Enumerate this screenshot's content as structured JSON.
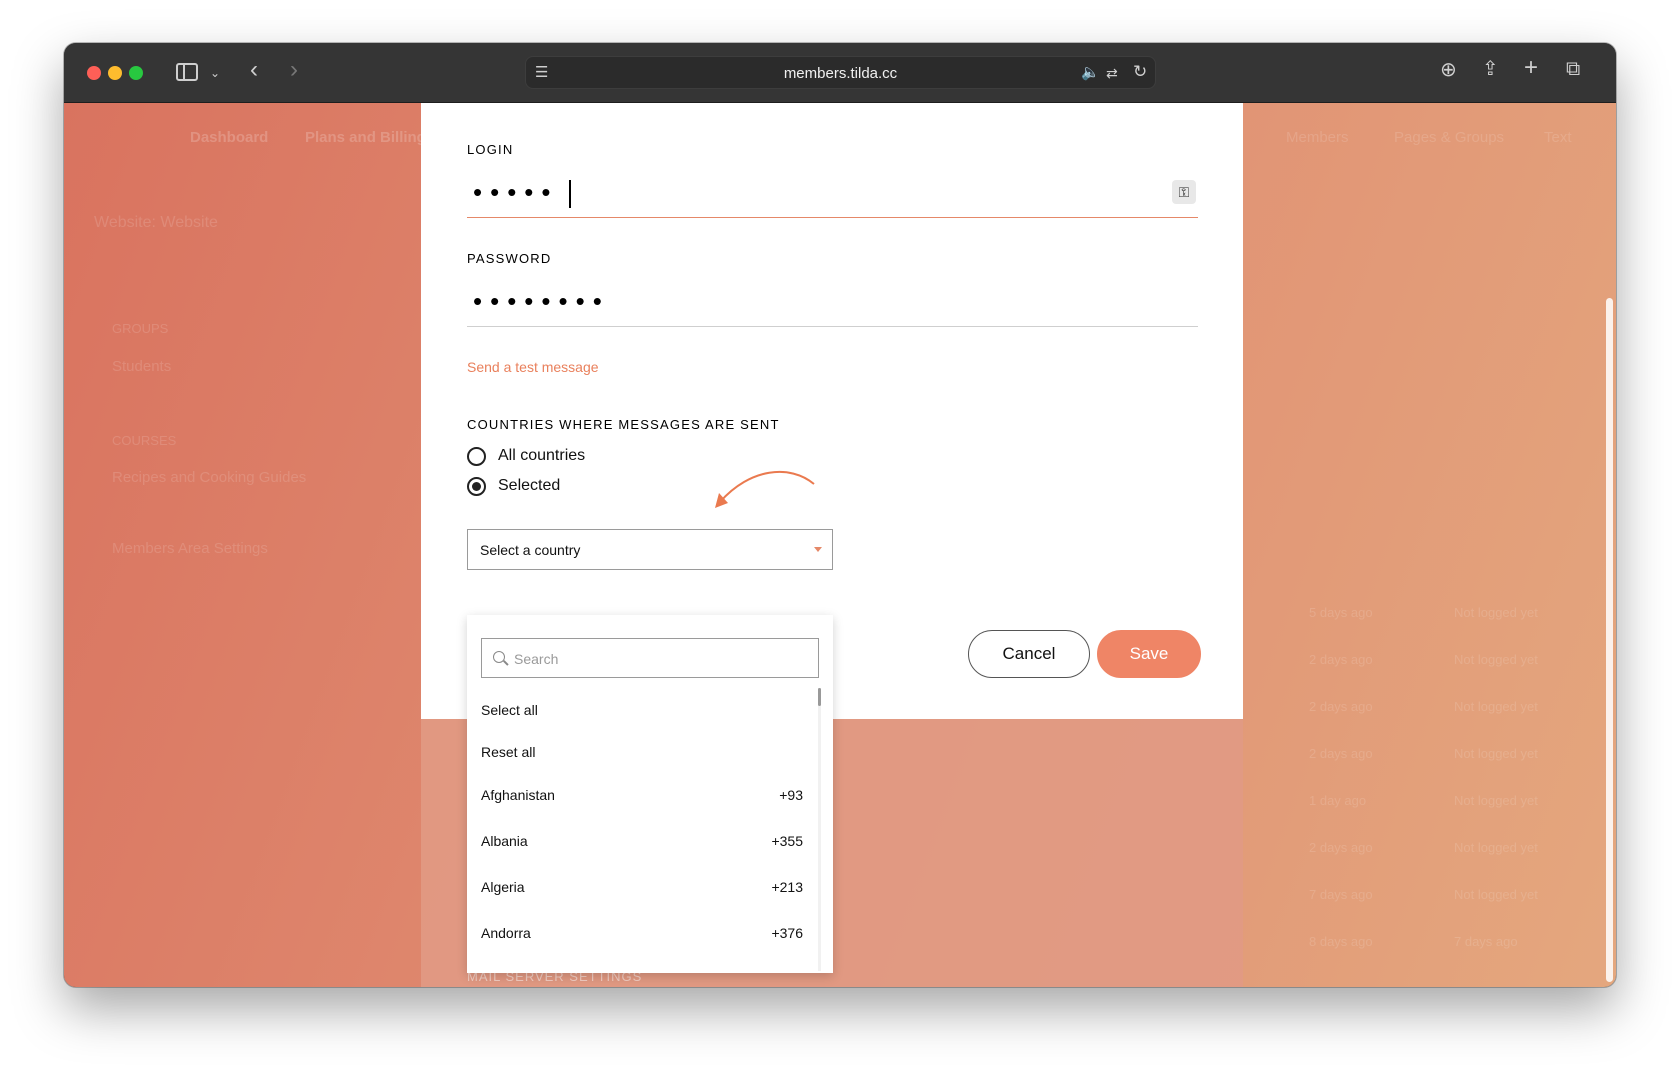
{
  "browser": {
    "url": "members.tilda.cc"
  },
  "background": {
    "nav_items": [
      "Dashboard",
      "Plans and Billing"
    ],
    "right_nav_items": [
      "Members",
      "Pages & Groups",
      "Text"
    ],
    "sidebar_title": "Website: Website",
    "sections": [
      "GROUPS",
      "Students",
      "COURSES",
      "Recipes and Cooking Guides",
      "Members Area Settings"
    ],
    "list_col_dates": [
      "5 days ago",
      "2 days ago",
      "2 days ago",
      "2 days ago",
      "1 day ago",
      "2 days ago",
      "7 days ago",
      "8 days ago"
    ],
    "list_col_status": [
      "Not logged yet",
      "Not logged yet",
      "Not logged yet",
      "Not logged yet",
      "Not logged yet",
      "Not logged yet",
      "Not logged yet",
      "7 days ago"
    ],
    "below_label": "MAIL SERVER SETTINGS"
  },
  "modal": {
    "login_label": "LOGIN",
    "login_value": "•••••",
    "password_label": "PASSWORD",
    "password_value": "••••••••",
    "test_link": "Send a test message",
    "countries_label": "COUNTRIES WHERE MESSAGES ARE SENT",
    "radio_all": "All countries",
    "radio_selected": "Selected",
    "radio_selected_checked": true,
    "select_placeholder": "Select a country",
    "cancel_label": "Cancel",
    "save_label": "Save",
    "accent_color": "#ef8566"
  },
  "dropdown": {
    "search_placeholder": "Search",
    "select_all": "Select all",
    "reset_all": "Reset all",
    "countries": [
      {
        "name": "Afghanistan",
        "code": "+93"
      },
      {
        "name": "Albania",
        "code": "+355"
      },
      {
        "name": "Algeria",
        "code": "+213"
      },
      {
        "name": "Andorra",
        "code": "+376"
      }
    ]
  }
}
